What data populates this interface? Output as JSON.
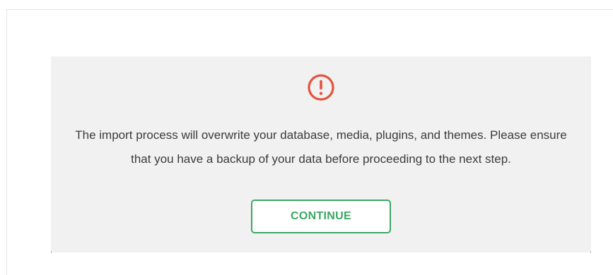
{
  "notice": {
    "icon": "exclamation-circle-icon",
    "icon_color": "#e5533c",
    "message": "The import process will overwrite your database, media, plugins, and themes. Please ensure that you have a backup of your data before proceeding to the next step.",
    "continue_label": "CONTINUE",
    "accent_color": "#3aa863"
  }
}
